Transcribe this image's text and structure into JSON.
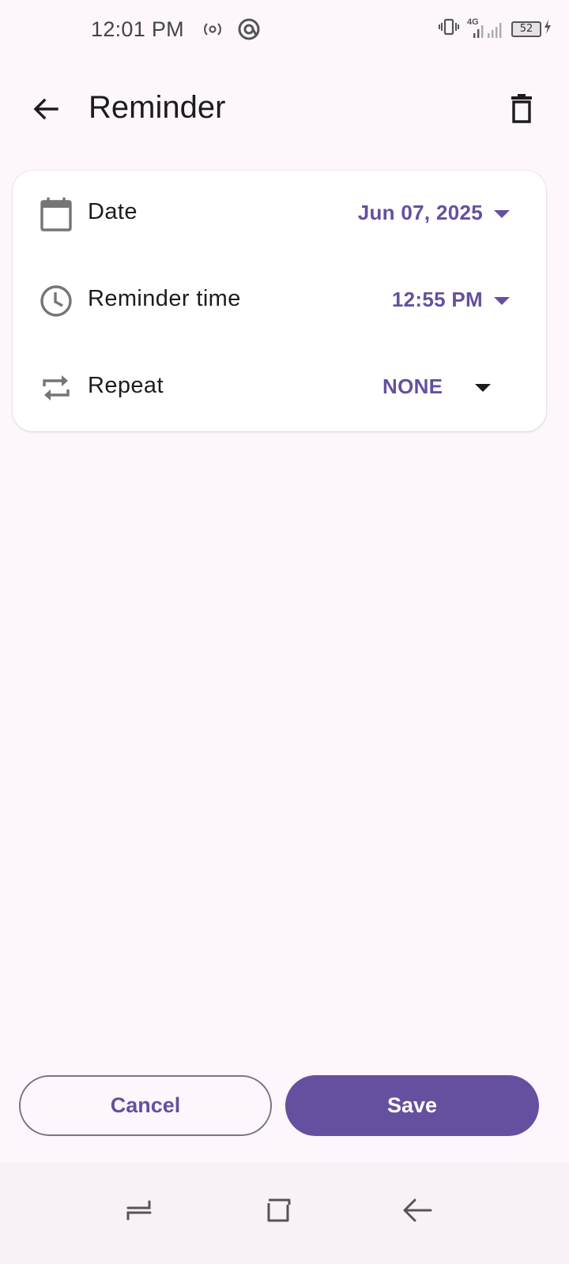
{
  "status_bar": {
    "time": "12:01 PM",
    "network": "4G",
    "battery": "52",
    "icons": [
      "hotspot-icon",
      "at-sign-icon",
      "vibrate-icon",
      "signal-icon",
      "charging-icon"
    ]
  },
  "app_bar": {
    "title": "Reminder",
    "back_icon": "arrow-back-icon",
    "delete_icon": "trash-icon"
  },
  "settings": [
    {
      "id": "date",
      "icon": "calendar-icon",
      "label": "Date",
      "value": "Jun 07, 2025"
    },
    {
      "id": "time",
      "icon": "clock-icon",
      "label": "Reminder time",
      "value": "12:55 PM"
    },
    {
      "id": "repeat",
      "icon": "repeat-icon",
      "label": "Repeat",
      "value": "NONE"
    }
  ],
  "actions": {
    "cancel_label": "Cancel",
    "save_label": "Save"
  },
  "colors": {
    "accent": "#65509f",
    "background": "#fdf7fd",
    "card": "#ffffff",
    "text": "#1d1b20",
    "icon_gray": "#757575"
  },
  "nav_bar": {
    "icons": [
      "recents-icon",
      "home-icon",
      "back-icon"
    ]
  }
}
